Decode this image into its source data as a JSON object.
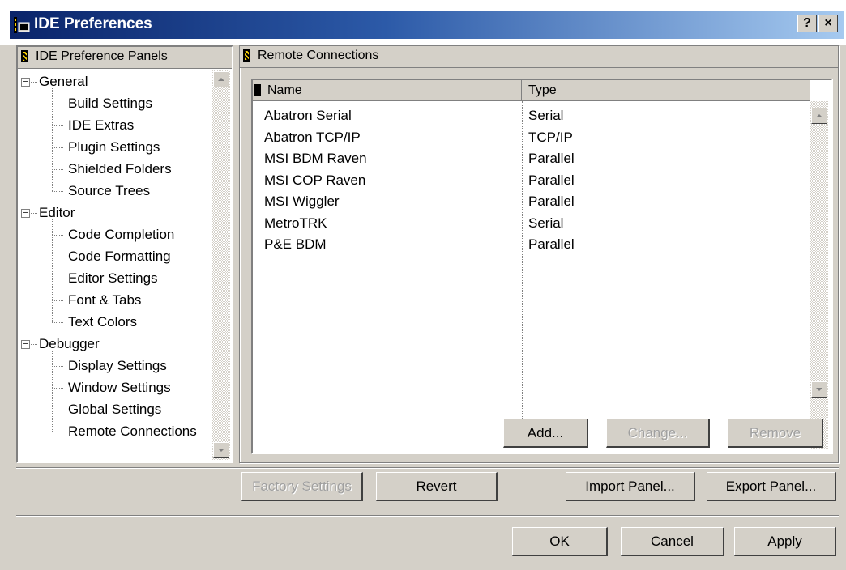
{
  "window": {
    "title": "IDE Preferences",
    "help_label": "?",
    "close_label": "×"
  },
  "left_panel": {
    "header": "IDE Preference Panels",
    "groups": [
      {
        "label": "General",
        "expander": "−",
        "items": [
          "Build Settings",
          "IDE Extras",
          "Plugin Settings",
          "Shielded Folders",
          "Source Trees"
        ]
      },
      {
        "label": "Editor",
        "expander": "−",
        "items": [
          "Code Completion",
          "Code Formatting",
          "Editor Settings",
          "Font & Tabs",
          "Text Colors"
        ]
      },
      {
        "label": "Debugger",
        "expander": "−",
        "items": [
          "Display Settings",
          "Window Settings",
          "Global Settings",
          "Remote Connections"
        ]
      }
    ]
  },
  "right_panel": {
    "header": "Remote Connections",
    "columns": {
      "name": "Name",
      "type": "Type"
    },
    "rows": [
      {
        "name": "Abatron Serial",
        "type": "Serial"
      },
      {
        "name": "Abatron TCP/IP",
        "type": "TCP/IP"
      },
      {
        "name": "MSI BDM Raven",
        "type": "Parallel"
      },
      {
        "name": "MSI COP Raven",
        "type": "Parallel"
      },
      {
        "name": "MSI Wiggler",
        "type": "Parallel"
      },
      {
        "name": "MetroTRK",
        "type": "Serial"
      },
      {
        "name": "P&E BDM",
        "type": "Parallel"
      }
    ],
    "add_label": "Add...",
    "change_label": "Change...",
    "remove_label": "Remove"
  },
  "panel_buttons": {
    "factory_label": "Factory Settings",
    "revert_label": "Revert",
    "import_label": "Import Panel...",
    "export_label": "Export Panel..."
  },
  "dialog_buttons": {
    "ok_label": "OK",
    "cancel_label": "Cancel",
    "apply_label": "Apply"
  }
}
